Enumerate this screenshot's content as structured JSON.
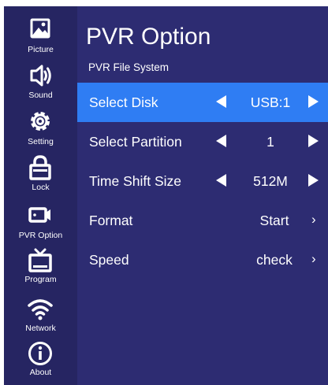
{
  "colors": {
    "background": "#2d2c72",
    "sidebar": "#262562",
    "selected_row": "#2f7df3",
    "text": "#ffffff"
  },
  "sidebar": {
    "items": [
      {
        "label": "Picture",
        "icon": "picture-icon"
      },
      {
        "label": "Sound",
        "icon": "speaker-icon"
      },
      {
        "label": "Setting",
        "icon": "gear-icon"
      },
      {
        "label": "Lock",
        "icon": "lock-icon"
      },
      {
        "label": "PVR Option",
        "icon": "video-camera-icon"
      },
      {
        "label": "Program",
        "icon": "tv-icon"
      },
      {
        "label": "Network",
        "icon": "wifi-icon"
      },
      {
        "label": "About",
        "icon": "info-icon"
      }
    ]
  },
  "header": {
    "title": "PVR Option",
    "subtitle": "PVR File System"
  },
  "menu": {
    "rows": [
      {
        "label": "Select Disk",
        "value": "USB:1",
        "control": "arrows",
        "selected": true
      },
      {
        "label": "Select Partition",
        "value": "1",
        "control": "arrows",
        "selected": false
      },
      {
        "label": "Time Shift Size",
        "value": "512M",
        "control": "arrows",
        "selected": false
      },
      {
        "label": "Format",
        "value": "Start",
        "control": "chevron",
        "chevron": "›",
        "selected": false
      },
      {
        "label": "Speed",
        "value": "check",
        "control": "chevron",
        "chevron": "›",
        "selected": false
      }
    ]
  }
}
